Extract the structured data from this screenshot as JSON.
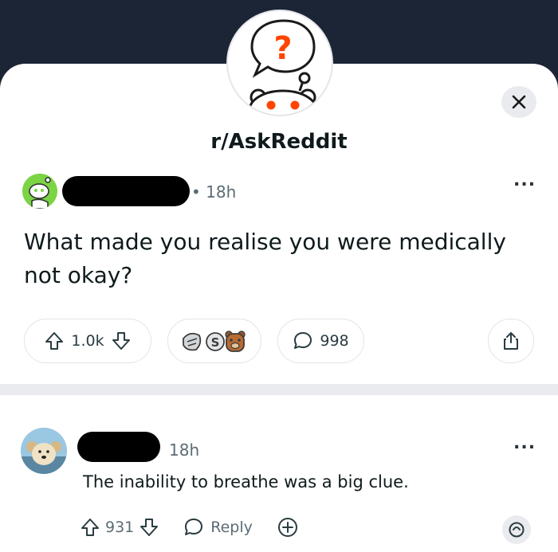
{
  "subreddit": {
    "name": "r/AskReddit"
  },
  "post": {
    "age": "18h",
    "title": "What made you realise you were medically not okay?",
    "votes": "1.0k",
    "comments": "998"
  },
  "menu": {
    "more": "..."
  },
  "comment": {
    "age": "18h",
    "text": "The inability to breathe was a big clue.",
    "votes": "931",
    "reply_label": "Reply"
  },
  "icons": {
    "close": "close-icon",
    "upvote": "upvote-icon",
    "downvote": "downvote-icon",
    "comment": "comment-bubble-icon",
    "share": "share-icon",
    "awards": "award-icons",
    "add": "plus-circle-icon",
    "give_award": "award-icon"
  },
  "colors": {
    "header_bg": "#1c2536",
    "accent": "#ff4500",
    "op_avatar": "#7bd444"
  }
}
